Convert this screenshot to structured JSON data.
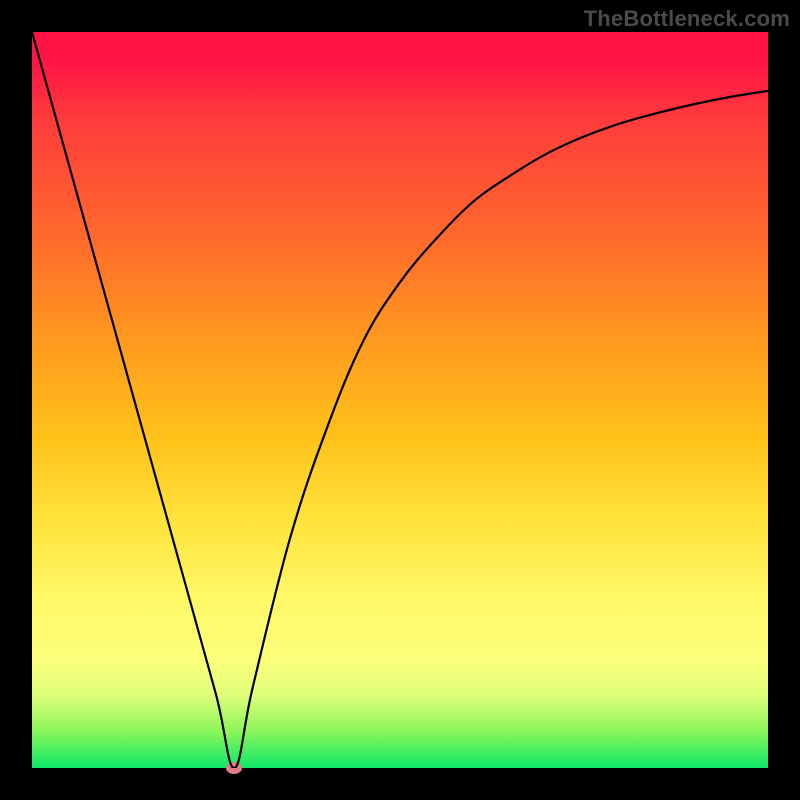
{
  "watermark": "TheBottleneck.com",
  "chart_data": {
    "type": "line",
    "title": "",
    "xlabel": "",
    "ylabel": "",
    "xlim": [
      0,
      100
    ],
    "ylim": [
      0,
      100
    ],
    "series": [
      {
        "name": "curve",
        "x": [
          0,
          5,
          10,
          15,
          20,
          25,
          27.5,
          30,
          35,
          40,
          45,
          50,
          55,
          60,
          65,
          70,
          75,
          80,
          85,
          90,
          95,
          100
        ],
        "y": [
          100,
          82,
          64,
          46,
          28,
          10,
          0,
          11,
          31,
          46,
          58,
          66,
          72,
          77,
          80.5,
          83.5,
          85.8,
          87.6,
          89,
          90.2,
          91.2,
          92
        ]
      }
    ],
    "marker": {
      "x": 27.5,
      "y": 0,
      "color": "#e57b87"
    },
    "colors": {
      "curve": "#000000",
      "gradient_top": "#ff1445",
      "gradient_bottom": "#0fe86a"
    }
  }
}
